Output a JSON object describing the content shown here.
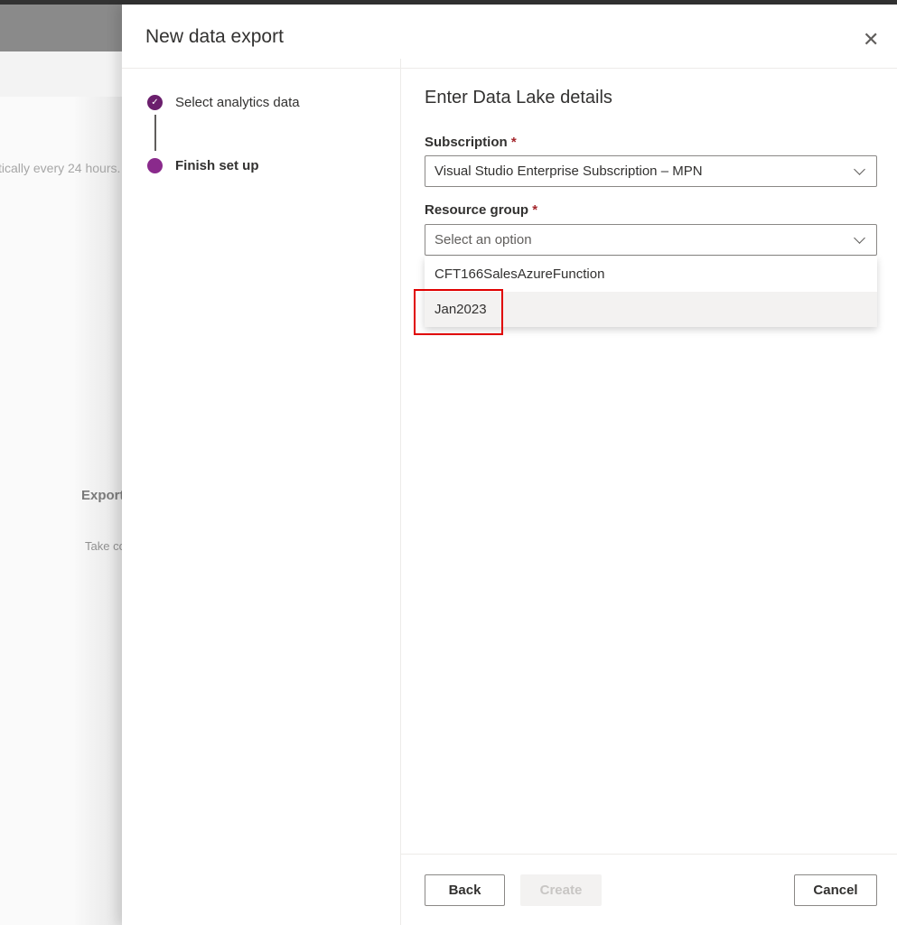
{
  "background": {
    "hint_text": "tically every 24 hours.",
    "card_title": "Export",
    "card_text": "Take co"
  },
  "panel": {
    "title": "New data export",
    "close_icon": "close-icon"
  },
  "steps": [
    {
      "label": "Select analytics data",
      "status": "completed"
    },
    {
      "label": "Finish set up",
      "status": "current"
    }
  ],
  "form": {
    "heading": "Enter Data Lake details",
    "subscription": {
      "label": "Subscription",
      "required": "*",
      "value": "Visual Studio Enterprise Subscription – MPN"
    },
    "resource_group": {
      "label": "Resource group",
      "required": "*",
      "placeholder": "Select an option",
      "options": [
        "CFT166SalesAzureFunction",
        "Jan2023"
      ],
      "hovered": "Jan2023"
    }
  },
  "footer": {
    "back": "Back",
    "create": "Create",
    "cancel": "Cancel"
  },
  "colors": {
    "accent": "#8a2a8c",
    "highlight": "#e00000"
  }
}
